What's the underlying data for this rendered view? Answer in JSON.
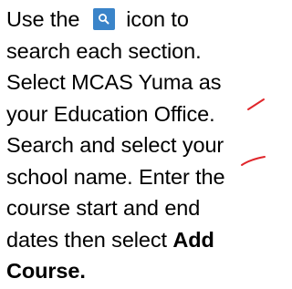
{
  "instructions": {
    "line1_before_icon": "Use the",
    "line1_after_icon": "icon to",
    "line2": "search each section.",
    "line3": "Select MCAS Yuma as",
    "line4": "your Education Office.",
    "line5": "Search and select your",
    "line6": "school name.  Enter the",
    "line7": "course start and end",
    "line8_before_bold": "dates then select",
    "line8_bold": "Add",
    "line9_bold": "Course."
  },
  "icons": {
    "inline_icon": "search-icon",
    "inline_icon_color": "#3a84c9",
    "annotation_color": "#e0262b"
  }
}
